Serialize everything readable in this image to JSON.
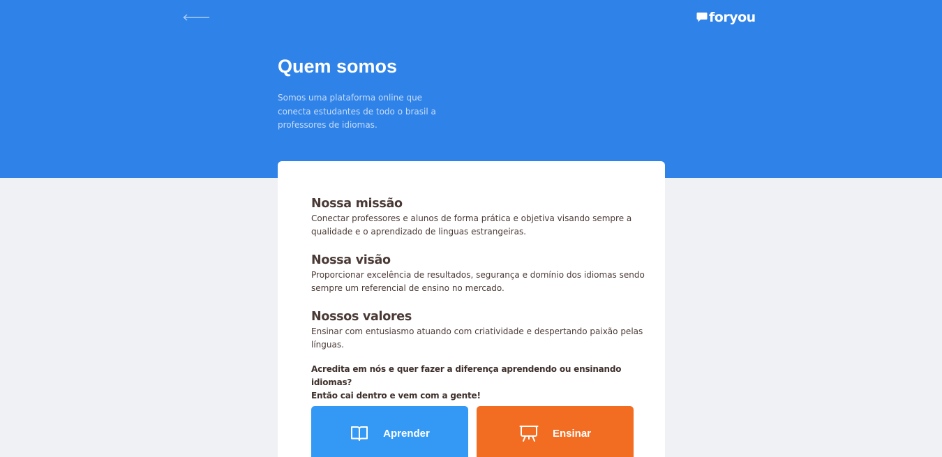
{
  "header": {
    "back_icon": "arrow-left-icon",
    "logo_text": "foryou",
    "logo_icon": "chat-bubble-icon",
    "title": "Quem somos",
    "subtitle": "Somos uma plataforma online que conecta estudantes de todo o brasil a professores de idiomas."
  },
  "sections": [
    {
      "title": "Nossa missão",
      "text": "Conectar professores e alunos de forma prática e objetiva visando sempre a qualidade e o aprendizado de linguas estrangeiras."
    },
    {
      "title": "Nossa visão",
      "text": "Proporcionar excelência de resultados, segurança e domínio dos idiomas sendo sempre um referencial de ensino no mercado."
    },
    {
      "title": "Nossos valores",
      "text": "Ensinar com entusiasmo atuando com criatividade e despertando paixão pelas línguas."
    }
  ],
  "cta": {
    "line1": "Acredita em nós e quer fazer a diferença aprendendo ou ensinando idiomas?",
    "line2": "Então cai dentro e vem com a gente!"
  },
  "actions": {
    "learn": {
      "label": "Aprender",
      "icon": "open-book-icon",
      "color": "#3399f5"
    },
    "teach": {
      "label": "Ensinar",
      "icon": "presentation-board-icon",
      "color": "#f26d22"
    }
  },
  "colors": {
    "hero_bg": "#2f83e8",
    "page_bg": "#eff1f5",
    "card_bg": "#ffffff",
    "text_dark": "#4a3a36"
  }
}
